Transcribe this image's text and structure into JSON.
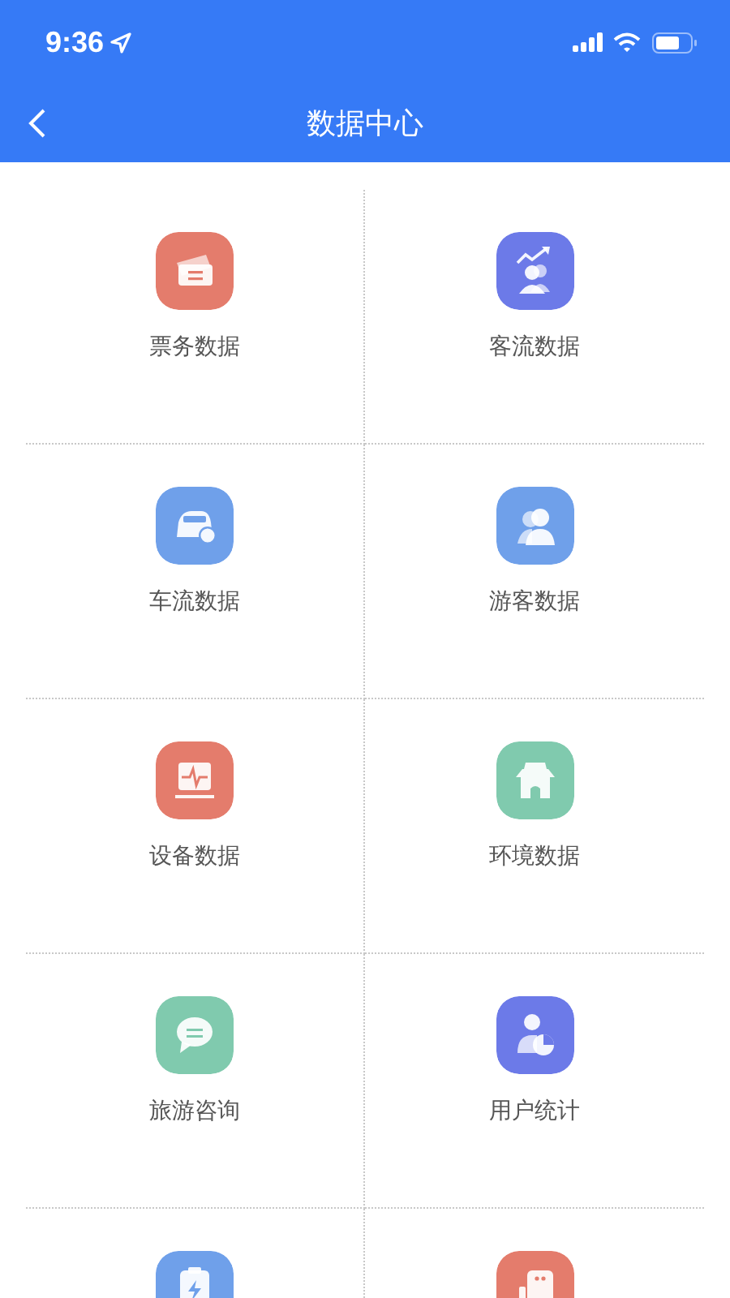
{
  "status_bar": {
    "time": "9:36"
  },
  "nav_bar": {
    "title": "数据中心"
  },
  "tiles": [
    {
      "kind": "ticket",
      "color": "#e47c6c",
      "label": "票务数据"
    },
    {
      "kind": "crowd",
      "color": "#6c7ae8",
      "label": "客流数据"
    },
    {
      "kind": "car",
      "color": "#6fa0ea",
      "label": "车流数据"
    },
    {
      "kind": "visitor",
      "color": "#6fa0ea",
      "label": "游客数据"
    },
    {
      "kind": "monitor",
      "color": "#e47c6c",
      "label": "设备数据"
    },
    {
      "kind": "building",
      "color": "#80caae",
      "label": "环境数据"
    },
    {
      "kind": "chat",
      "color": "#80caae",
      "label": "旅游咨询"
    },
    {
      "kind": "user-chart",
      "color": "#6c7ae8",
      "label": "用户统计"
    },
    {
      "kind": "battery",
      "color": "#6fa0ea"
    },
    {
      "kind": "device",
      "color": "#e47c6c"
    }
  ]
}
